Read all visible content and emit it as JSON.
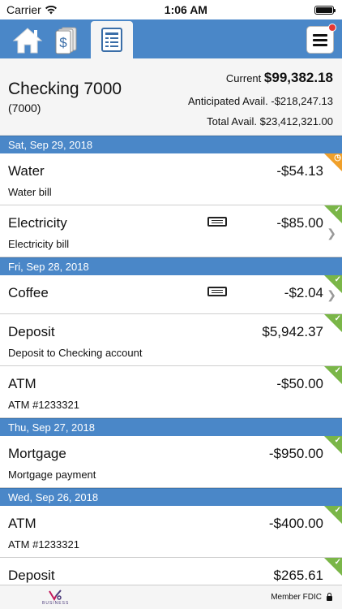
{
  "status_bar": {
    "carrier": "Carrier",
    "time": "1:06 AM"
  },
  "nav": {
    "tabs": [
      "home-icon",
      "money-icon",
      "register-icon"
    ],
    "active_tab": 2
  },
  "account": {
    "name": "Checking 7000",
    "number": "(7000)",
    "current_label": "Current",
    "current_value": "$99,382.18",
    "anticipated_label": "Anticipated Avail.",
    "anticipated_value": "-$218,247.13",
    "total_label": "Total Avail.",
    "total_value": "$23,412,321.00"
  },
  "groups": [
    {
      "date": "Sat, Sep 29, 2018",
      "items": [
        {
          "title": "Water",
          "desc": "Water bill",
          "amount": "-$54.13",
          "status": "pending"
        },
        {
          "title": "Electricity",
          "desc": "Electricity bill",
          "amount": "-$85.00",
          "status": "cleared",
          "memo": true,
          "chevron": true
        }
      ]
    },
    {
      "date": "Fri, Sep 28, 2018",
      "items": [
        {
          "title": "Coffee",
          "desc": "",
          "amount": "-$2.04",
          "status": "cleared",
          "memo": true,
          "chevron": true
        },
        {
          "title": "Deposit",
          "desc": "Deposit to Checking account",
          "amount": "$5,942.37",
          "status": "cleared"
        },
        {
          "title": "ATM",
          "desc": "ATM #1233321",
          "amount": "-$50.00",
          "status": "cleared"
        }
      ]
    },
    {
      "date": "Thu, Sep 27, 2018",
      "items": [
        {
          "title": "Mortgage",
          "desc": "Mortgage payment",
          "amount": "-$950.00",
          "status": "cleared"
        }
      ]
    },
    {
      "date": "Wed, Sep 26, 2018",
      "items": [
        {
          "title": "ATM",
          "desc": "ATM #1233321",
          "amount": "-$400.00",
          "status": "cleared"
        },
        {
          "title": "Deposit",
          "desc": "",
          "amount": "$265.61",
          "status": "cleared"
        }
      ]
    }
  ],
  "footer": {
    "logo_text": "BUSINESS",
    "fdic": "Member FDIC"
  },
  "colors": {
    "accent": "#4a87c8",
    "cleared": "#7ab648",
    "pending": "#f0a02a"
  }
}
